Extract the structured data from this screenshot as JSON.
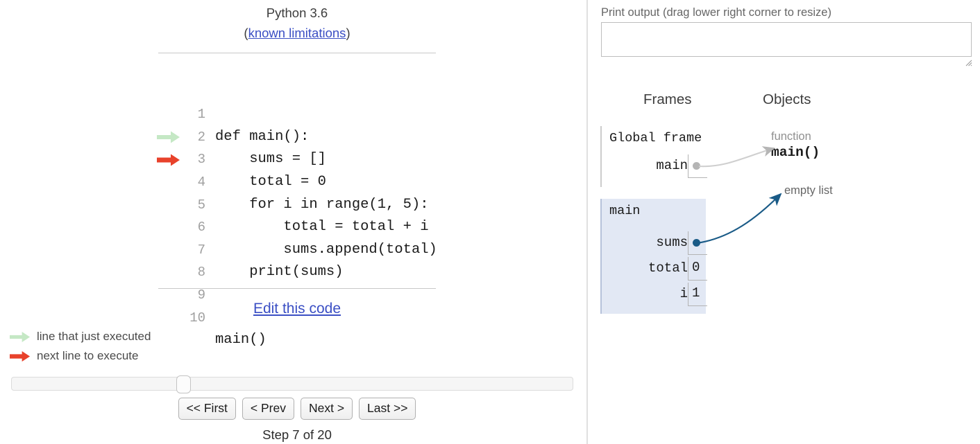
{
  "header": {
    "version": "Python 3.6",
    "limitations_prefix": "(",
    "limitations_link": "known limitations",
    "limitations_suffix": ")"
  },
  "code": {
    "lines": [
      {
        "num": "1",
        "text": "def main():",
        "arrow": "none"
      },
      {
        "num": "2",
        "text": "    sums = []",
        "arrow": "none"
      },
      {
        "num": "3",
        "text": "    total = 0",
        "arrow": "none"
      },
      {
        "num": "4",
        "text": "    for i in range(1, 5):",
        "arrow": "green"
      },
      {
        "num": "5",
        "text": "        total = total + i",
        "arrow": "red"
      },
      {
        "num": "6",
        "text": "        sums.append(total)",
        "arrow": "none"
      },
      {
        "num": "7",
        "text": "    print(sums)",
        "arrow": "none"
      },
      {
        "num": "8",
        "text": "",
        "arrow": "none"
      },
      {
        "num": "9",
        "text": "",
        "arrow": "none"
      },
      {
        "num": "10",
        "text": "main()",
        "arrow": "none"
      }
    ]
  },
  "edit_link": "Edit this code",
  "legend": {
    "just_executed": "line that just executed",
    "next_to_execute": "next line to execute"
  },
  "slider": {
    "position_percent": 30
  },
  "controls": {
    "first": "<< First",
    "prev": "< Prev",
    "next": "Next >",
    "last": "Last >>",
    "step_label": "Step 7 of 20",
    "current_step": 7,
    "total_steps": 20
  },
  "print_output": {
    "label": "Print output (drag lower right corner to resize)",
    "value": "",
    "placeholder": ""
  },
  "visualization": {
    "frames_header": "Frames",
    "objects_header": "Objects",
    "frames": [
      {
        "title": "Global frame",
        "active": false,
        "vars": [
          {
            "name": "main",
            "value": "",
            "is_pointer": true
          }
        ]
      },
      {
        "title": "main",
        "active": true,
        "vars": [
          {
            "name": "sums",
            "value": "",
            "is_pointer": true
          },
          {
            "name": "total",
            "value": "0",
            "is_pointer": false
          },
          {
            "name": "i",
            "value": "1",
            "is_pointer": false
          }
        ]
      }
    ],
    "objects": [
      {
        "type_label": "function",
        "value": "main()"
      },
      {
        "type_label": "empty list",
        "value": ""
      }
    ]
  },
  "colors": {
    "green_arrow": "#c5e8c5",
    "red_arrow": "#e8422b",
    "link": "#3b4fc4",
    "frame_active_bg": "#e2e8f4",
    "pointer_blue": "#1a5b87",
    "pointer_gray": "#b5b5b5"
  }
}
